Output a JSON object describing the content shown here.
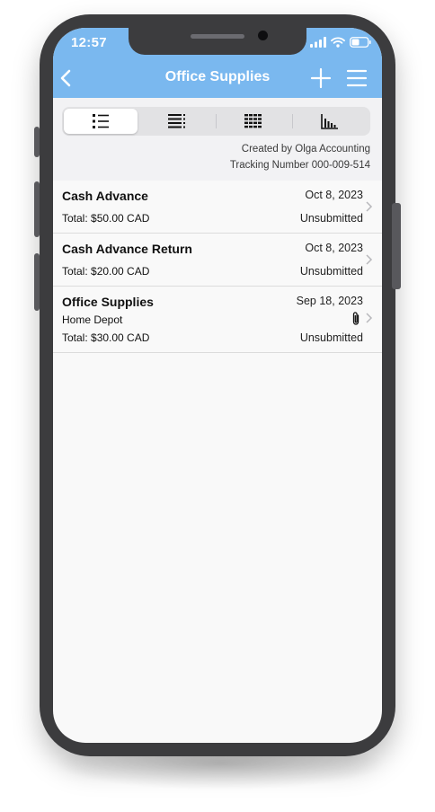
{
  "status_bar": {
    "time": "12:57"
  },
  "nav": {
    "title": "Office Supplies"
  },
  "view_tabs": [
    {
      "icon": "list-view-icon",
      "active": true
    },
    {
      "icon": "detail-list-icon",
      "active": false
    },
    {
      "icon": "grid-view-icon",
      "active": false
    },
    {
      "icon": "bar-chart-icon",
      "active": false
    }
  ],
  "meta": {
    "created_by": "Created by Olga Accounting",
    "tracking": "Tracking Number 000-009-514"
  },
  "entries": [
    {
      "title": "Cash Advance",
      "date": "Oct 8, 2023",
      "subtitle": "",
      "total": "Total: $50.00 CAD",
      "status": "Unsubmitted",
      "has_attachment": false
    },
    {
      "title": "Cash Advance Return",
      "date": "Oct 8, 2023",
      "subtitle": "",
      "total": "Total: $20.00 CAD",
      "status": "Unsubmitted",
      "has_attachment": false
    },
    {
      "title": "Office Supplies",
      "date": "Sep 18, 2023",
      "subtitle": "Home Depot",
      "total": "Total: $30.00 CAD",
      "status": "Unsubmitted",
      "has_attachment": true
    }
  ],
  "colors": {
    "accent": "#7ab8ef",
    "frame": "#3c3c3e",
    "background": "#f9f9f9"
  }
}
